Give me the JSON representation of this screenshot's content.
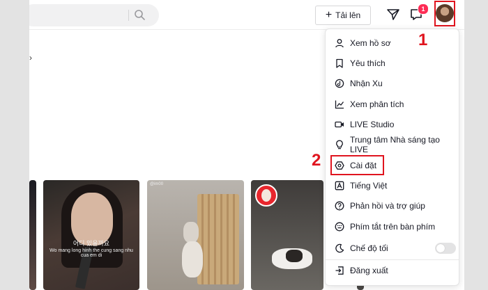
{
  "header": {
    "upload_label": "Tải lên",
    "notification_count": "1"
  },
  "annotations": {
    "step1": "1",
    "step2": "2"
  },
  "menu": {
    "items": [
      {
        "label": "Xem hồ sơ",
        "icon": "user-icon"
      },
      {
        "label": "Yêu thích",
        "icon": "bookmark-icon"
      },
      {
        "label": "Nhận Xu",
        "icon": "coin-icon"
      },
      {
        "label": "Xem phân tích",
        "icon": "analytics-icon"
      },
      {
        "label": "LIVE Studio",
        "icon": "live-camera-icon"
      },
      {
        "label": "Trung tâm Nhà sáng tạo LIVE",
        "icon": "lightbulb-icon"
      },
      {
        "label": "Cài đặt",
        "icon": "gear-icon"
      },
      {
        "label": "Tiếng Việt",
        "icon": "language-icon"
      },
      {
        "label": "Phản hồi và trợ giúp",
        "icon": "help-icon"
      },
      {
        "label": "Phím tắt trên bàn phím",
        "icon": "keyboard-icon"
      },
      {
        "label": "Chế độ tối",
        "icon": "moon-icon",
        "toggle": false
      },
      {
        "label": "Đăng xuất",
        "icon": "logout-icon"
      }
    ]
  },
  "video_thumbnails": {
    "video2_watermark": "@im00",
    "video1_caption_line1": "어디 있을까요",
    "video1_caption_line2": "Wo mang long hinh the cung sang nhu cua em di"
  },
  "colors": {
    "accent": "#e0141e",
    "badge": "#fe2c55"
  }
}
